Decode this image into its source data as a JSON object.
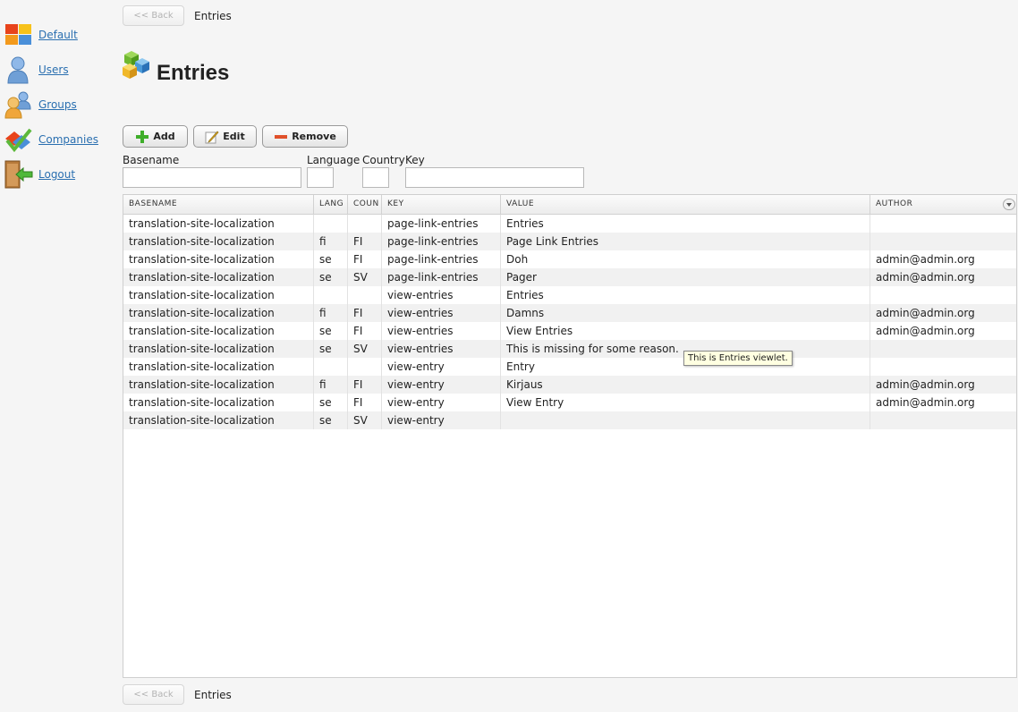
{
  "sidebar": {
    "items": [
      {
        "label": "Default",
        "icon": "default-windows-icon"
      },
      {
        "label": "Users",
        "icon": "user-icon"
      },
      {
        "label": "Groups",
        "icon": "group-icon"
      },
      {
        "label": "Companies",
        "icon": "companies-icon"
      },
      {
        "label": "Logout",
        "icon": "logout-door-icon"
      }
    ]
  },
  "nav": {
    "back_label": "<< Back",
    "breadcrumb": "Entries"
  },
  "page": {
    "title": "Entries",
    "title_icon": "cubes-icon"
  },
  "toolbar": {
    "add_label": "Add",
    "edit_label": "Edit",
    "remove_label": "Remove"
  },
  "filters": {
    "basename_label": "Basename",
    "language_label": "Language",
    "country_label": "Country",
    "key_label": "Key",
    "basename_value": "",
    "language_value": "",
    "country_value": "",
    "key_value": ""
  },
  "table": {
    "headers": [
      "BASENAME",
      "LANG",
      "COUN",
      "KEY",
      "VALUE",
      "AUTHOR"
    ],
    "rows": [
      [
        "translation-site-localization",
        "",
        "",
        "page-link-entries",
        "Entries",
        ""
      ],
      [
        "translation-site-localization",
        "fi",
        "FI",
        "page-link-entries",
        "Page Link Entries",
        ""
      ],
      [
        "translation-site-localization",
        "se",
        "FI",
        "page-link-entries",
        "Doh",
        "admin@admin.org"
      ],
      [
        "translation-site-localization",
        "se",
        "SV",
        "page-link-entries",
        "Pager",
        "admin@admin.org"
      ],
      [
        "translation-site-localization",
        "",
        "",
        "view-entries",
        "Entries",
        ""
      ],
      [
        "translation-site-localization",
        "fi",
        "FI",
        "view-entries",
        "Damns",
        "admin@admin.org"
      ],
      [
        "translation-site-localization",
        "se",
        "FI",
        "view-entries",
        "View Entries",
        "admin@admin.org"
      ],
      [
        "translation-site-localization",
        "se",
        "SV",
        "view-entries",
        "This is missing for some reason.",
        ""
      ],
      [
        "translation-site-localization",
        "",
        "",
        "view-entry",
        "Entry",
        ""
      ],
      [
        "translation-site-localization",
        "fi",
        "FI",
        "view-entry",
        "Kirjaus",
        "admin@admin.org"
      ],
      [
        "translation-site-localization",
        "se",
        "FI",
        "view-entry",
        "View Entry",
        "admin@admin.org"
      ],
      [
        "translation-site-localization",
        "se",
        "SV",
        "view-entry",
        "",
        ""
      ]
    ]
  },
  "tooltip": {
    "text": "This is Entries viewlet."
  },
  "colors": {
    "link": "#2a6fb0",
    "alt_row": "#f1f1f1",
    "tooltip_bg": "#ffffe1"
  }
}
